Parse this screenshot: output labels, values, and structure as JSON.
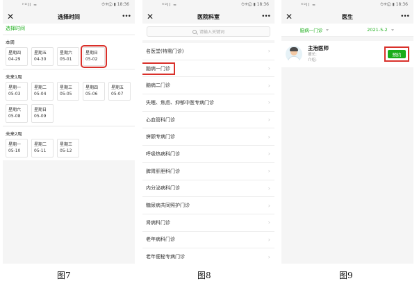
{
  "status": {
    "signal": "ᴴᴰll ≈",
    "right": "⏱✳ⓒ ▮ 18:36"
  },
  "screen7": {
    "nav_title": "选择时间",
    "selected_label": "选择时间",
    "weeks": [
      {
        "title": "本周",
        "days": [
          {
            "weekday": "星期四",
            "date": "04-29"
          },
          {
            "weekday": "星期五",
            "date": "04-30"
          },
          {
            "weekday": "星期六",
            "date": "05-01"
          },
          {
            "weekday": "星期日",
            "date": "05-02",
            "highlighted": true
          }
        ]
      },
      {
        "title": "未来1周",
        "days": [
          {
            "weekday": "星期一",
            "date": "05-03"
          },
          {
            "weekday": "星期二",
            "date": "05-04"
          },
          {
            "weekday": "星期三",
            "date": "05-05"
          },
          {
            "weekday": "星期四",
            "date": "05-06"
          },
          {
            "weekday": "星期五",
            "date": "05-07"
          },
          {
            "weekday": "星期六",
            "date": "05-08"
          },
          {
            "weekday": "星期日",
            "date": "05-09"
          }
        ]
      },
      {
        "title": "未来2周",
        "days": [
          {
            "weekday": "星期一",
            "date": "05-10"
          },
          {
            "weekday": "星期二",
            "date": "05-11"
          },
          {
            "weekday": "星期三",
            "date": "05-12"
          }
        ]
      }
    ],
    "caption": "图7"
  },
  "screen8": {
    "nav_title": "医院科室",
    "search_placeholder": "请输入关键词",
    "departments": [
      {
        "label": "名医堂(特需门诊)"
      },
      {
        "label": "脑病一门诊",
        "highlighted": true
      },
      {
        "label": "脑病二门诊"
      },
      {
        "label": "失眠、焦虑、抑郁中医专病门诊"
      },
      {
        "label": "心血管科门诊"
      },
      {
        "label": "痹颤专病门诊"
      },
      {
        "label": "呼吸热病科门诊"
      },
      {
        "label": "脾胃肝胆科门诊"
      },
      {
        "label": "内分泌病科门诊"
      },
      {
        "label": "糖尿病共同照护门诊"
      },
      {
        "label": "肾病科门诊"
      },
      {
        "label": "老年病科门诊"
      },
      {
        "label": "老年便秘专病门诊"
      }
    ],
    "caption": "图8"
  },
  "screen9": {
    "nav_title": "医生",
    "filter_dept": "脑病一门诊",
    "filter_date": "2021-5-2",
    "doctor_title": "主治医师",
    "doctor_line1": "擅长:",
    "doctor_line2": "介绍:",
    "book_label": "预约",
    "caption": "图9"
  },
  "colors": {
    "accent_green": "#1aad19",
    "highlight_red": "#d9302a"
  },
  "icons": {
    "close": "close-icon",
    "more": "more-icon",
    "search": "search-icon",
    "chevron": "chevron-right-icon",
    "caret": "caret-down-icon"
  }
}
